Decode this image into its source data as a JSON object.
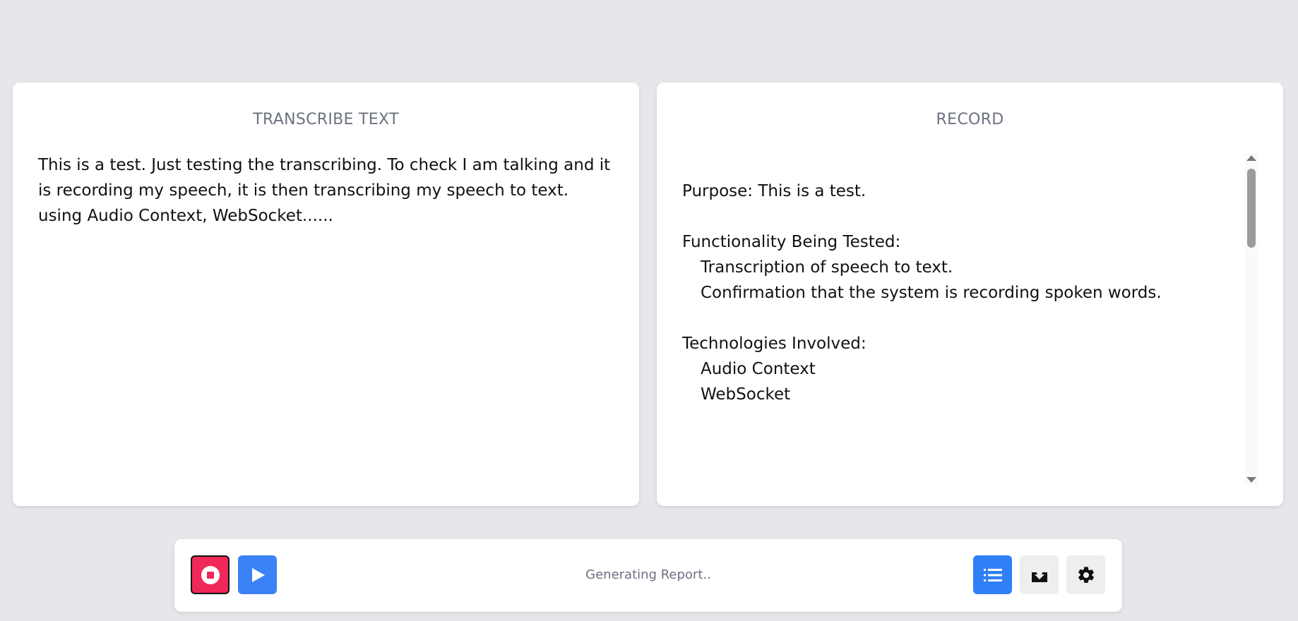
{
  "transcribe_panel": {
    "title": "TRANSCRIBE TEXT",
    "text": "This is a test. Just testing the transcribing. To check I am talking and it is recording my speech, it is then transcribing my speech to text. using Audio Context, WebSocket......"
  },
  "record_panel": {
    "title": "RECORD",
    "lines": [
      "Purpose: This is a test.",
      "",
      "Functionality Being Tested:",
      "Transcription of speech to text.",
      "Confirmation that the system is recording spoken words.",
      "",
      "Technologies Involved:",
      "Audio Context",
      "WebSocket"
    ]
  },
  "toolbar": {
    "status_text": "Generating Report..",
    "buttons": {
      "stop": {
        "icon": "stop-record-icon",
        "color": "#f0285a"
      },
      "play": {
        "icon": "play-icon",
        "color": "#3b82f6"
      },
      "list": {
        "icon": "list-icon",
        "color": "#2f80f7"
      },
      "download": {
        "icon": "download-icon",
        "color": "#eeeeee"
      },
      "settings": {
        "icon": "gear-icon",
        "color": "#eeeeee"
      }
    }
  },
  "colors": {
    "background": "#e5e7eb",
    "panel": "#ffffff",
    "title_gray": "#6b7280"
  }
}
